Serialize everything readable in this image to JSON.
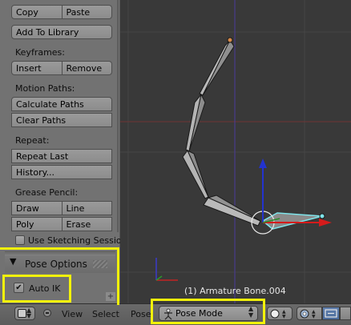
{
  "tool_shelf": {
    "copy": "Copy",
    "paste": "Paste",
    "add_to_library": "Add To Library",
    "keyframes_label": "Keyframes:",
    "insert": "Insert",
    "remove": "Remove",
    "motion_paths_label": "Motion Paths:",
    "calculate_paths": "Calculate Paths",
    "clear_paths": "Clear Paths",
    "repeat_label": "Repeat:",
    "repeat_last": "Repeat Last",
    "history": "History...",
    "grease_pencil_label": "Grease Pencil:",
    "draw": "Draw",
    "line": "Line",
    "poly": "Poly",
    "erase": "Erase",
    "use_sketching_session": "Use Sketching Sessio"
  },
  "pose_options": {
    "title": "Pose Options",
    "auto_ik_label": "Auto IK",
    "auto_ik_checked": true,
    "check_glyph": "✔",
    "arrow_glyph": "▼"
  },
  "viewport": {
    "active_bone_label": "(1) Armature Bone.004",
    "grid_color": "#464646",
    "x_axis_color": "#7a3a3a",
    "y_axis_color": "#3a6a2a",
    "bone_fill": "#b4b4b4",
    "selected_bone_color": "#7fe4ea",
    "gizmo_x_color": "#e02020",
    "gizmo_z_color": "#2030d0"
  },
  "header": {
    "view": "View",
    "select": "Select",
    "pose": "Pose",
    "mode": "Pose Mode",
    "plus_glyph": "+"
  },
  "highlight_color": "#f2f20a"
}
